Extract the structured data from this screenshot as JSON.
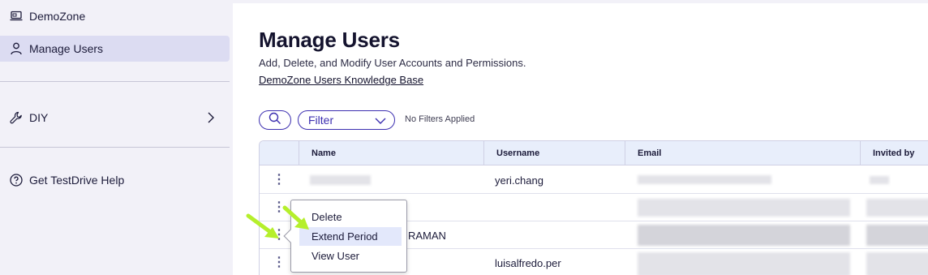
{
  "sidebar": {
    "items": [
      {
        "label": "DemoZone",
        "icon": "laptop-icon"
      },
      {
        "label": "Manage Users",
        "icon": "user-icon"
      },
      {
        "label": "DIY",
        "icon": "wrench-icon"
      },
      {
        "label": "Get TestDrive Help",
        "icon": "help-circle-icon"
      }
    ]
  },
  "main": {
    "title": "Manage Users",
    "subtitle": "Add, Delete, and Modify User Accounts and Permissions.",
    "kb_link": "DemoZone Users Knowledge Base"
  },
  "toolbar": {
    "filter_label": "Filter",
    "filter_status": "No Filters Applied"
  },
  "table": {
    "columns": [
      "Name",
      "Username",
      "Email",
      "Invited by"
    ],
    "rows": [
      {
        "name": "",
        "username": "yeri.chang",
        "email": ""
      },
      {
        "name": "",
        "username": "",
        "email": ""
      },
      {
        "name": "RAMAN",
        "username": "",
        "email": ""
      },
      {
        "name": "",
        "username": "luisalfredo.per",
        "email": ""
      }
    ]
  },
  "context_menu": {
    "items": [
      "Delete",
      "Extend Period",
      "View User"
    ],
    "highlighted": "Extend Period"
  },
  "colors": {
    "accent": "#3c2fb0",
    "annotation_arrow": "#b5ef2c"
  }
}
